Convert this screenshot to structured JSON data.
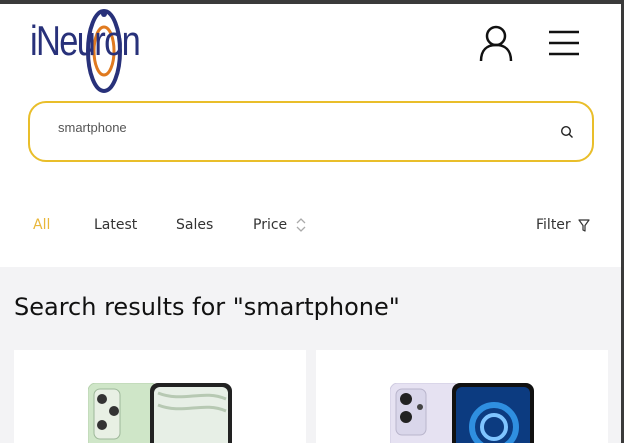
{
  "header": {
    "logo_text": "iNeuron",
    "user_icon": "user-icon",
    "menu_icon": "hamburger-menu-icon"
  },
  "search": {
    "value": "smartphone",
    "placeholder": "",
    "icon": "search-icon"
  },
  "tabs": [
    {
      "label": "All",
      "active": true
    },
    {
      "label": "Latest",
      "active": false
    },
    {
      "label": "Sales",
      "active": false
    },
    {
      "label": "Price",
      "active": false,
      "icon": "sort-icon"
    }
  ],
  "filter": {
    "label": "Filter",
    "icon": "funnel-icon"
  },
  "results": {
    "title": "Search results for \"smartphone\""
  },
  "colors": {
    "accent": "#e9be2a",
    "logo_blue": "#28317a",
    "logo_orange": "#e07a1f",
    "results_bg": "#f3f3f5"
  }
}
